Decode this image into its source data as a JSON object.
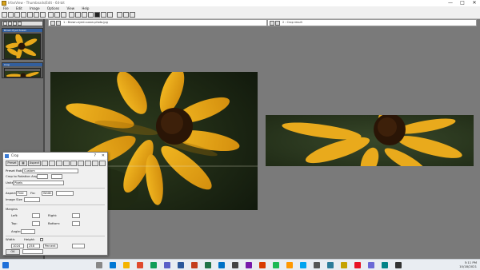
{
  "window": {
    "title": "IrfanView - Thumbnails/Edit - 64-bit",
    "min": "—",
    "max": "□",
    "close": "✕"
  },
  "menu": [
    "File",
    "Edit",
    "Image",
    "Options",
    "View",
    "Help"
  ],
  "panels": {
    "thumb1": {
      "title": "Brown Eyed Susan"
    },
    "thumb2": {
      "title": "Crop"
    }
  },
  "image_left": {
    "header": "1 : Brown-eyed-susan-photo.jpg"
  },
  "image_right": {
    "header": "2 : Crop result"
  },
  "crop": {
    "title": "Crop",
    "tabs": [
      "Preset",
      "Aspect",
      "Apply"
    ],
    "preset_label": "Preset Ratio:",
    "preset_value": "Custom",
    "rotate_label": "Crop to Rotation Angle:",
    "units_label": "Units:",
    "units_value": "Pixels",
    "mode_label": "Aspect:",
    "mode_value": "Free",
    "fix_label": "Fix:",
    "fix_value": "Width",
    "image_size": "Image Size",
    "margins_label": "Margins",
    "left_label": "Left:",
    "right_label": "Right:",
    "top_label": "Top:",
    "bottom_label": "Bottom:",
    "angle_label": "Angle:",
    "width_label": "Width:",
    "height_label": "Height:",
    "percent_label": "Percent",
    "width_value": "1024",
    "height_value": "258",
    "ok": "OK",
    "cancel": "Cancel"
  },
  "taskbar": {
    "time": "5:11 PM",
    "date": "10/18/2021"
  }
}
